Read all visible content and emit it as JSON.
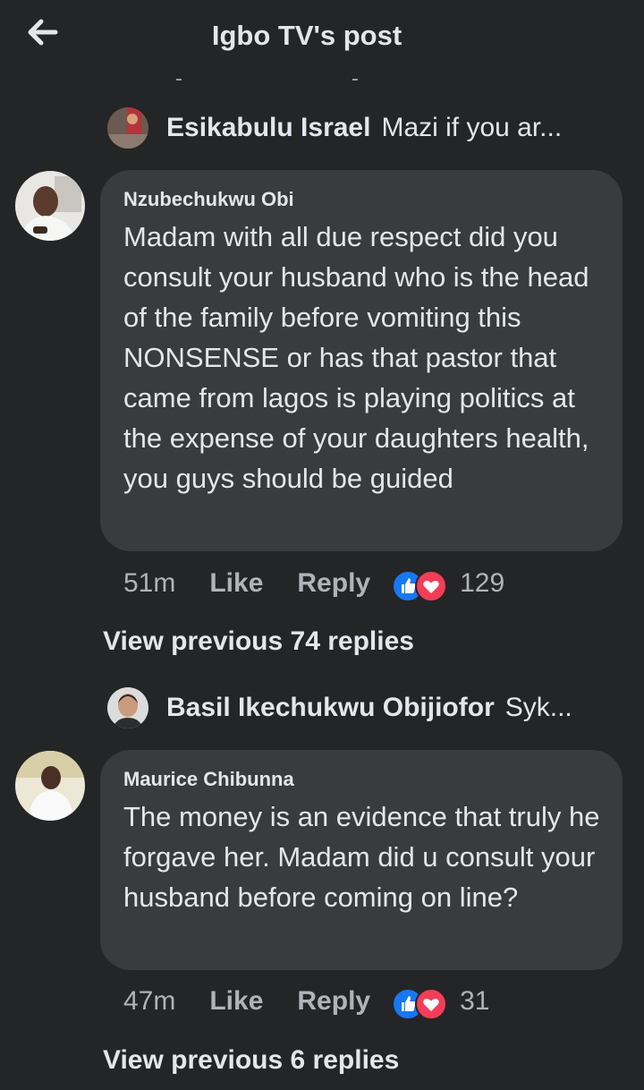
{
  "header": {
    "title": "Igbo TV's post",
    "back_icon": "arrow-left-icon"
  },
  "threads": [
    {
      "preview": {
        "name": "Esikabulu Israel",
        "text": "Mazi if you ar..."
      },
      "comment": {
        "author": "Nzubechukwu Obi",
        "text": "Madam with all due respect did you consult your husband who is the head of the family before vomiting this NONSENSE or has that pastor that came from lagos is playing politics at the expense of your daughters health, you guys should be guided",
        "time": "51m",
        "like_label": "Like",
        "reply_label": "Reply",
        "reaction_count": "129"
      },
      "view_previous": "View previous 74 replies"
    },
    {
      "preview": {
        "name": "Basil Ikechukwu Obijiofor",
        "text": "Syk..."
      },
      "comment": {
        "author": "Maurice Chibunna",
        "text": "The money is an evidence that truly he forgave her. Madam did u consult your husband before coming on line?",
        "time": "47m",
        "like_label": "Like",
        "reply_label": "Reply",
        "reaction_count": "31"
      },
      "view_previous": "View previous 6 replies"
    }
  ],
  "colors": {
    "background": "#242526",
    "bubble": "#3a3b3c",
    "like_blue": "#1877f2",
    "love_red": "#f33e58",
    "secondary_text": "#b0b3b8"
  }
}
